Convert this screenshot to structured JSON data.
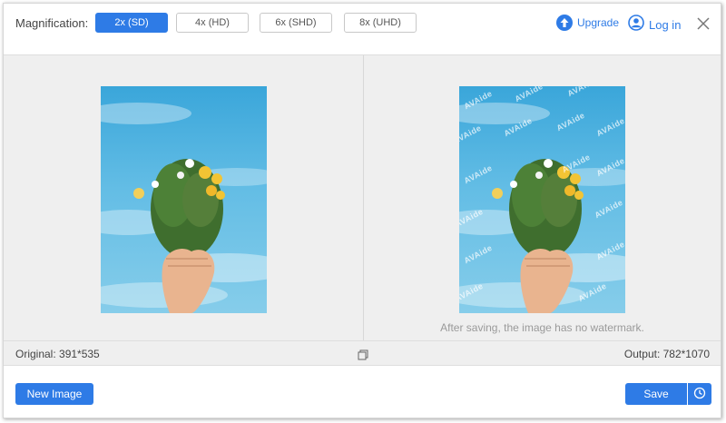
{
  "toolbar": {
    "magnification_label": "Magnification:",
    "options": [
      "2x (SD)",
      "4x (HD)",
      "6x (SHD)",
      "8x (UHD)"
    ],
    "selected": "2x (SD)",
    "upgrade_label": "Upgrade",
    "login_label": "Log in"
  },
  "preview": {
    "watermark_text": "AVAide",
    "notice": "After saving, the image has no watermark."
  },
  "info": {
    "original": "Original: 391*535",
    "output": "Output: 782*1070"
  },
  "actions": {
    "new_image": "New Image",
    "save": "Save"
  },
  "colors": {
    "accent": "#2e7be6",
    "panel_bg": "#efefef"
  }
}
